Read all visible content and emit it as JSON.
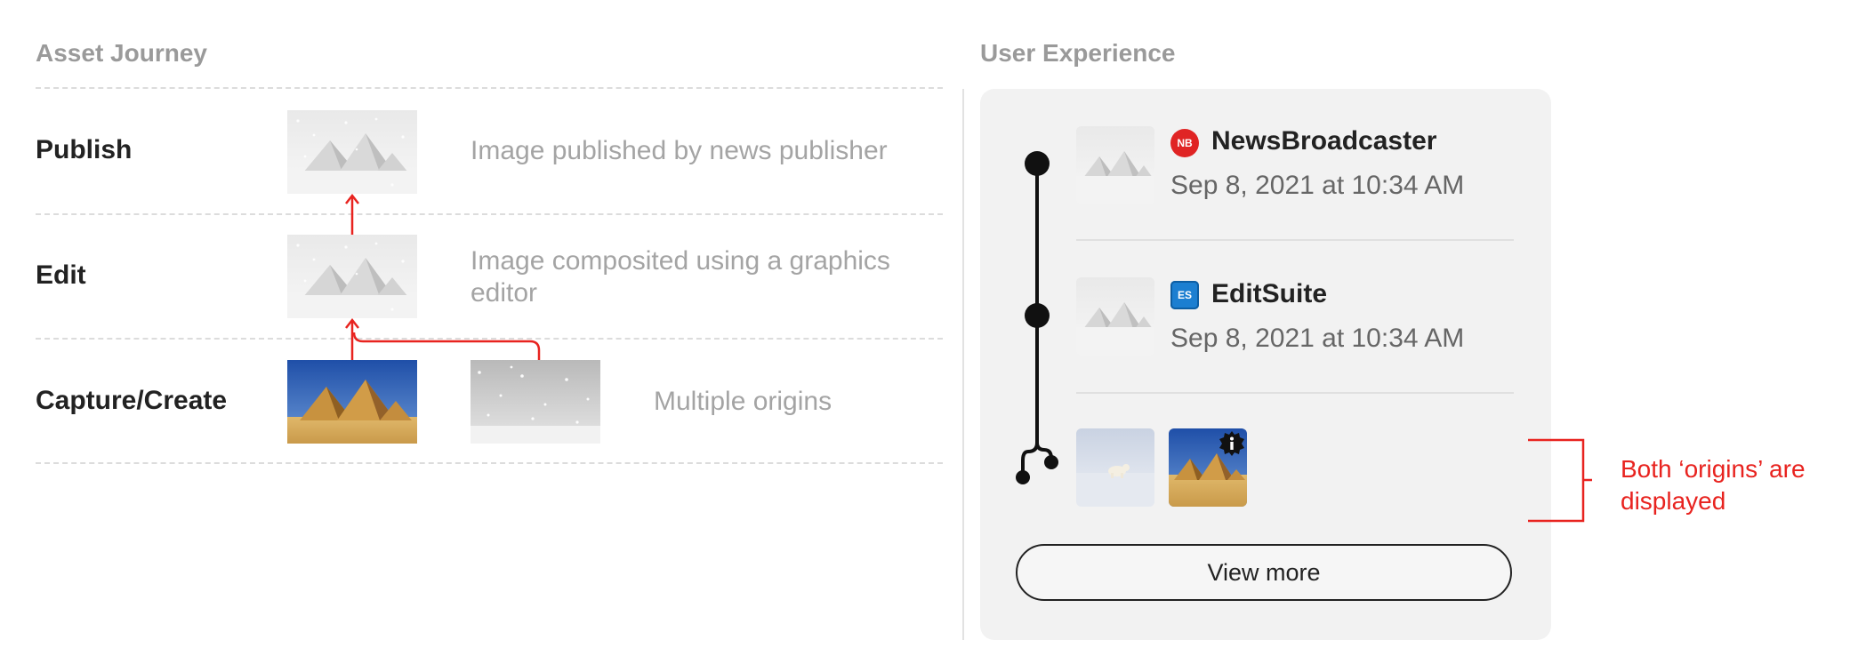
{
  "journey": {
    "title": "Asset Journey",
    "stages": [
      {
        "label": "Publish",
        "description": "Image published by news publisher"
      },
      {
        "label": "Edit",
        "description": "Image composited using a graphics editor"
      },
      {
        "label": "Capture/Create",
        "description": "Multiple origins"
      }
    ]
  },
  "experience": {
    "title": "User Experience",
    "entries": [
      {
        "badge": "NB",
        "name": "NewsBroadcaster",
        "date": "Sep 8, 2021 at 10:34 AM"
      },
      {
        "badge": "ES",
        "name": "EditSuite",
        "date": "Sep 8, 2021 at 10:34 AM"
      }
    ],
    "view_more": "View more",
    "annotation": "Both ‘origins’ are displayed"
  },
  "colors": {
    "accent_red": "#e8231f",
    "nb_badge": "#e02424",
    "es_badge": "#1c7fd1"
  }
}
